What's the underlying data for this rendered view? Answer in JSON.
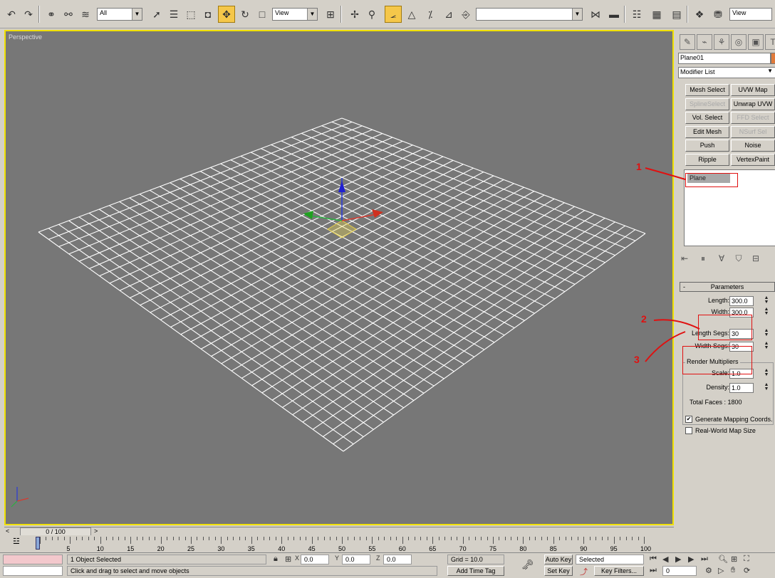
{
  "toolbar": {
    "selection_filter": "All",
    "ref_coord": "View",
    "right_view_combo": "View",
    "named_selection": ""
  },
  "viewport": {
    "label": "Perspective",
    "grid_cells": 30
  },
  "command_panel": {
    "object_name": "Plane01",
    "modifier_list": "Modifier List",
    "modifier_buttons": [
      {
        "label": "Mesh Select",
        "enabled": true
      },
      {
        "label": "UVW Map",
        "enabled": true
      },
      {
        "label": "SplineSelect",
        "enabled": false
      },
      {
        "label": "Unwrap UVW",
        "enabled": true
      },
      {
        "label": "Vol. Select",
        "enabled": true
      },
      {
        "label": "FFD Select",
        "enabled": false
      },
      {
        "label": "Edit Mesh",
        "enabled": true
      },
      {
        "label": "NSurf Sel",
        "enabled": false
      },
      {
        "label": "Push",
        "enabled": true
      },
      {
        "label": "Noise",
        "enabled": true
      },
      {
        "label": "Ripple",
        "enabled": true
      },
      {
        "label": "VertexPaint",
        "enabled": true
      }
    ],
    "stack_item": "Plane",
    "parameters": {
      "title": "Parameters",
      "length_label": "Length:",
      "length": "300.0",
      "width_label": "Width:",
      "width": "300.0",
      "length_segs_label": "Length Segs:",
      "length_segs": "30",
      "width_segs_label": "Width Segs:",
      "width_segs": "30",
      "render_multipliers": "Render Multipliers",
      "scale_label": "Scale:",
      "scale": "1.0",
      "density_label": "Density:",
      "density": "1.0",
      "total_faces": "Total Faces : 1800",
      "generate_mapping": "Generate Mapping Coords.",
      "generate_mapping_checked": true,
      "real_world": "Real-World Map Size",
      "real_world_checked": false
    }
  },
  "annotations": [
    "1",
    "2",
    "3"
  ],
  "timeline": {
    "slider": "0 / 100",
    "ticks": [
      "5",
      "10",
      "15",
      "20",
      "25",
      "30",
      "35",
      "40",
      "45",
      "50",
      "55",
      "60",
      "65",
      "70",
      "75",
      "80",
      "85",
      "90",
      "95",
      "100"
    ]
  },
  "status": {
    "selection": "1 Object Selected",
    "prompt": "Click and drag to select and move objects",
    "x_label": "X",
    "x": "0.0",
    "y_label": "Y",
    "y": "0.0",
    "z_label": "Z",
    "z": "0.0",
    "grid": "Grid = 10.0",
    "add_time_tag": "Add Time Tag",
    "auto_key": "Auto Key",
    "set_key": "Set Key",
    "key_mode": "Selected",
    "key_filters": "Key Filters...",
    "frame": "0"
  },
  "colors": {
    "viewport_bg": "#777777",
    "viewport_border": "#f0e000",
    "grid_line": "#ffffff",
    "annotation": "#e01010",
    "gizmo_x": "#d03020",
    "gizmo_y": "#20a020",
    "gizmo_z": "#2020d0"
  }
}
